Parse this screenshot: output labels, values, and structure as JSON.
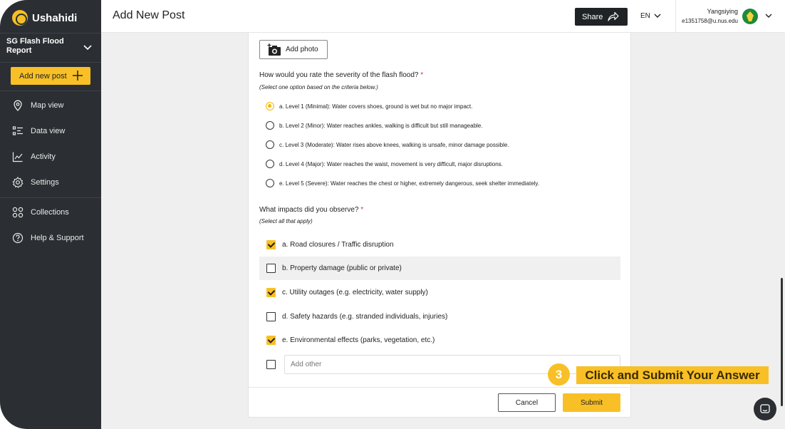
{
  "app": {
    "name": "Ushahidi"
  },
  "sidebar": {
    "deployment_title": "SG Flash Flood Report",
    "add_post_label": "Add new post",
    "items": [
      {
        "label": "Map view",
        "icon": "map-pin-icon"
      },
      {
        "label": "Data view",
        "icon": "list-icon"
      },
      {
        "label": "Activity",
        "icon": "activity-icon"
      },
      {
        "label": "Settings",
        "icon": "gear-icon"
      },
      {
        "label": "Collections",
        "icon": "collections-icon"
      },
      {
        "label": "Help & Support",
        "icon": "help-icon"
      }
    ]
  },
  "header": {
    "title": "Add New Post",
    "share_label": "Share",
    "language": "EN",
    "user": {
      "name": "Yangsiying",
      "email": "e1351758@u.nus.edu"
    }
  },
  "form": {
    "add_photo_label": "Add photo",
    "severity": {
      "question": "How would you rate the severity of the flash flood?",
      "required_mark": "*",
      "hint": "(Select one option based on the criteria below.)",
      "selected_index": 0,
      "options": [
        "a. Level 1 (Minimal): Water covers shoes, ground is wet but no major impact.",
        "b. Level 2 (Minor): Water reaches ankles, walking is difficult but still manageable.",
        "c. Level 3 (Moderate): Water rises above knees, walking is unsafe, minor damage possible.",
        "d. Level 4 (Major): Water reaches the waist, movement is very difficult, major disruptions.",
        "e. Level 5 (Severe): Water reaches the chest or higher, extremely dangerous, seek shelter immediately."
      ]
    },
    "impacts": {
      "question": "What impacts did you observe?",
      "required_mark": "*",
      "hint": "(Select all that apply)",
      "options": [
        {
          "label": "a. Road closures / Traffic disruption",
          "checked": true
        },
        {
          "label": "b. Property damage (public or private)",
          "checked": false
        },
        {
          "label": "c. Utility outages (e.g. electricity, water supply)",
          "checked": true
        },
        {
          "label": "d. Safety hazards (e.g. stranded individuals, injuries)",
          "checked": false
        },
        {
          "label": "e. Environmental effects (parks, vegetation, etc.)",
          "checked": true
        }
      ],
      "other_placeholder": "Add other",
      "other_checked": false
    },
    "cancel_label": "Cancel",
    "submit_label": "Submit"
  },
  "annotation": {
    "step_number": "3",
    "text": "Click and Submit Your Answer"
  },
  "colors": {
    "accent": "#f8c026",
    "sidebar_bg": "#2b2f33",
    "page_bg": "#efefef"
  }
}
